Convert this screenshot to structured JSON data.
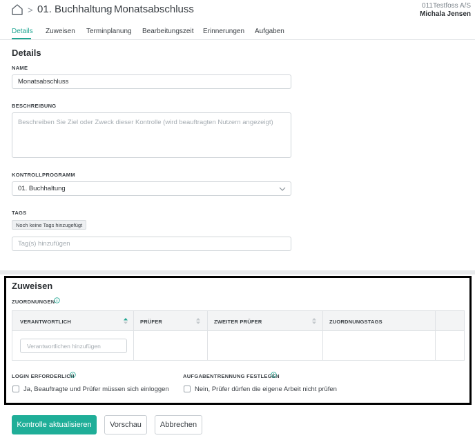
{
  "header": {
    "breadcrumb": [
      "01. Buchhaltung",
      "Monatsabschluss"
    ],
    "tenant": "011Testfoss A/S",
    "user": "Michala Jensen"
  },
  "tabs": [
    "Details",
    "Zuweisen",
    "Terminplanung",
    "Bearbeitungszeit",
    "Erinnerungen",
    "Aufgaben"
  ],
  "details": {
    "title": "Details",
    "name_label": "NAME",
    "name_value": "Monatsabschluss",
    "description_label": "BESCHREIBUNG",
    "description_placeholder": "Beschreiben Sie Ziel oder Zweck dieser Kontrolle (wird beauftragten Nutzern angezeigt)",
    "program_label": "KONTROLLPROGRAMM",
    "program_value": "01. Buchhaltung",
    "tags_label": "TAGS",
    "no_tags_chip": "Noch keine Tags hinzugefügt",
    "tags_placeholder": "Tag(s) hinzufügen"
  },
  "assign": {
    "title": "Zuweisen",
    "mappings_label": "ZUORDNUNGEN",
    "columns": [
      "VERANTWORTLICH",
      "PRÜFER",
      "ZWEITER PRÜFER",
      "ZUORDNUNGSTAGS"
    ],
    "responsible_placeholder": "Verantwortlichen hinzufügen",
    "login_label": "LOGIN ERFORDERLICH",
    "login_checkbox": "Ja, Beauftragte und Prüfer müssen sich einloggen",
    "segregation_label": "AUFGABENTRENNUNG FESTLEGEN",
    "segregation_checkbox": "Nein, Prüfer dürfen die eigene Arbeit nicht prüfen"
  },
  "actions": {
    "update": "Kontrolle aktualisieren",
    "preview": "Vorschau",
    "cancel": "Abbrechen"
  },
  "colors": {
    "accent": "#1fae98"
  }
}
